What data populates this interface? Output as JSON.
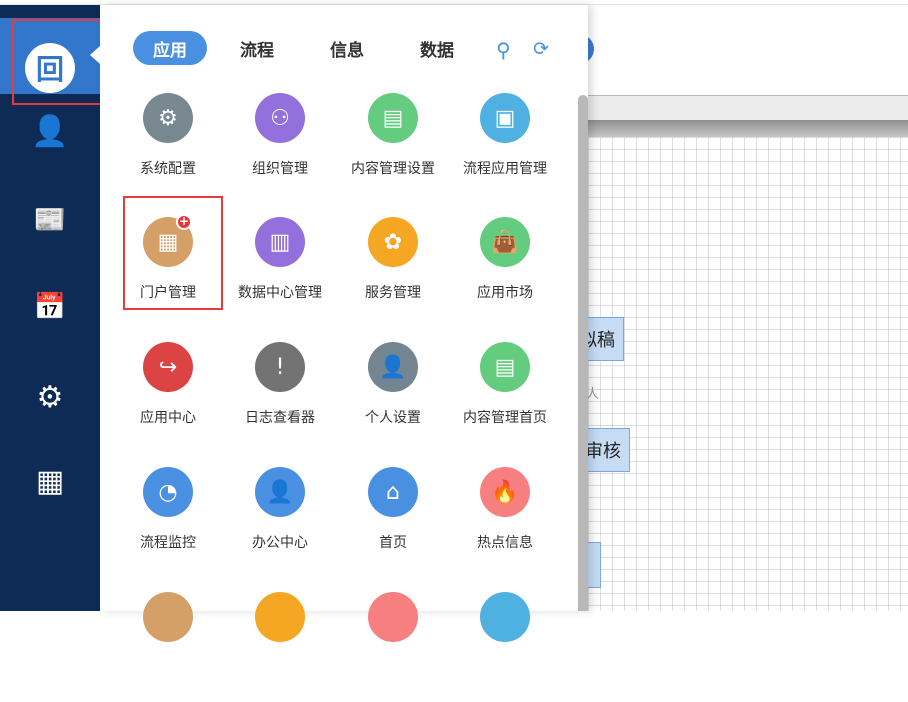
{
  "sidebar": {
    "logo": "回",
    "items": [
      {
        "name": "office",
        "glyph": "👤"
      },
      {
        "name": "news",
        "glyph": "📰"
      },
      {
        "name": "calendar",
        "glyph": "📅"
      },
      {
        "name": "user-settings",
        "glyph": "⚙"
      },
      {
        "name": "portal",
        "glyph": "▦"
      }
    ]
  },
  "panel": {
    "tabs": [
      "应用",
      "流程",
      "信息",
      "数据"
    ],
    "active_tab": 0,
    "apps": [
      {
        "label": "系统配置",
        "color": "#778891",
        "glyph": "⚙",
        "icon": "gear-icon"
      },
      {
        "label": "组织管理",
        "color": "#9370db",
        "glyph": "⚇",
        "icon": "org-chart-icon"
      },
      {
        "label": "内容管理设置",
        "color": "#63cc7f",
        "glyph": "▤",
        "icon": "content-settings-icon"
      },
      {
        "label": "流程应用管理",
        "color": "#4fb0e2",
        "glyph": "▣",
        "icon": "flow-app-icon"
      },
      {
        "label": "门户管理",
        "color": "#d4a067",
        "glyph": "▦",
        "icon": "portal-icon",
        "badge": "+"
      },
      {
        "label": "数据中心管理",
        "color": "#9370db",
        "glyph": "▥",
        "icon": "data-center-icon"
      },
      {
        "label": "服务管理",
        "color": "#f5a623",
        "glyph": "✿",
        "icon": "service-icon"
      },
      {
        "label": "应用市场",
        "color": "#63cc7f",
        "glyph": "👜",
        "icon": "app-market-icon"
      },
      {
        "label": "应用中心",
        "color": "#dc4343",
        "glyph": "↪",
        "icon": "app-center-icon"
      },
      {
        "label": "日志查看器",
        "color": "#737373",
        "glyph": "!",
        "icon": "log-viewer-icon"
      },
      {
        "label": "个人设置",
        "color": "#738590",
        "glyph": "👤",
        "icon": "personal-settings-icon"
      },
      {
        "label": "内容管理首页",
        "color": "#63cc7f",
        "glyph": "▤",
        "icon": "content-home-icon"
      },
      {
        "label": "流程监控",
        "color": "#4a90e2",
        "glyph": "◔",
        "icon": "speedometer-icon"
      },
      {
        "label": "办公中心",
        "color": "#4a90e2",
        "glyph": "👤",
        "icon": "office-center-icon"
      },
      {
        "label": "首页",
        "color": "#4a90e2",
        "glyph": "⌂",
        "icon": "home-icon"
      },
      {
        "label": "热点信息",
        "color": "#f77f7f",
        "glyph": "🔥",
        "icon": "hot-info-icon"
      },
      {
        "label": "",
        "color": "#d4a067",
        "glyph": "",
        "icon": "app-icon"
      },
      {
        "label": "",
        "color": "#f5a623",
        "glyph": "",
        "icon": "app-icon"
      },
      {
        "label": "",
        "color": "#f77f7f",
        "glyph": "",
        "icon": "app-icon"
      },
      {
        "label": "",
        "color": "#4fb0e2",
        "glyph": "",
        "icon": "app-icon"
      }
    ]
  },
  "canvas": {
    "nodes": [
      "拟稿",
      "审核",
      ""
    ],
    "edge_label": "人"
  }
}
